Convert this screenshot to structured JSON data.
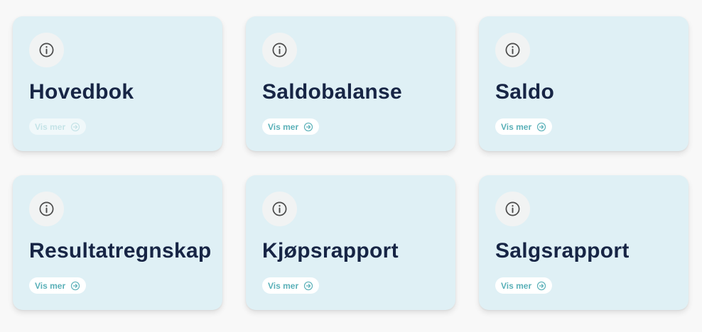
{
  "cards": [
    {
      "title": "Hovedbok",
      "more_label": "Vis mer",
      "more_faded": true
    },
    {
      "title": "Saldobalanse",
      "more_label": "Vis mer",
      "more_faded": false
    },
    {
      "title": "Saldo",
      "more_label": "Vis mer",
      "more_faded": false
    },
    {
      "title": "Resultatregnskap",
      "more_label": "Vis mer",
      "more_faded": false
    },
    {
      "title": "Kjøpsrapport",
      "more_label": "Vis mer",
      "more_faded": false
    },
    {
      "title": "Salgsrapport",
      "more_label": "Vis mer",
      "more_faded": false
    }
  ],
  "icons": {
    "info": "info-icon",
    "more": "arrow-circle-right-icon"
  },
  "colors": {
    "card_bg": "#dff0f5",
    "title": "#172545",
    "accent": "#5ab0b8"
  }
}
